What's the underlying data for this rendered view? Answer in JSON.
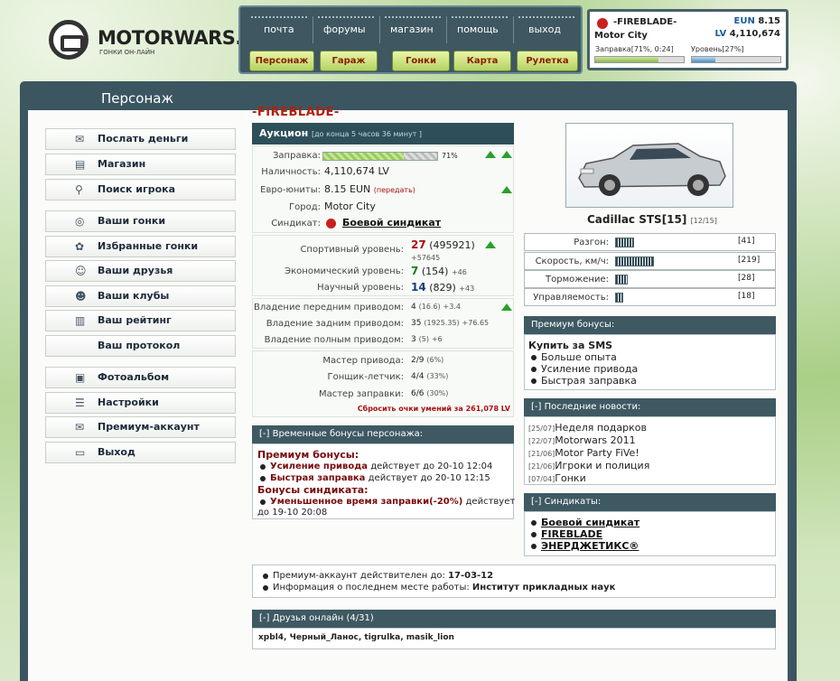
{
  "logo": {
    "name": "MOTORWARS.RU",
    "subtitle": "ГОНКИ ОН-ЛАЙН"
  },
  "nav": {
    "top": [
      "почта",
      "форумы",
      "магазин",
      "помощь",
      "выход"
    ],
    "buttons": [
      "Персонаж",
      "Гараж",
      "Гонки",
      "Карта",
      "Рулетка"
    ]
  },
  "player": {
    "name": "-FIREBLADE-",
    "city": "Motor City",
    "eun_label": "EUN",
    "eun": "8.15",
    "lv_label": "LV",
    "lv": "4,110,674",
    "fuel_label": "Заправка[71%, 0:24]",
    "fuel_pct": 71,
    "level_label": "Уровень[27%]",
    "level_pct": 27
  },
  "sidebar": {
    "title": "Персонаж",
    "items": [
      {
        "label": "Послать деньги",
        "icon": "money-icon"
      },
      {
        "label": "Магазин",
        "icon": "shop-icon"
      },
      {
        "label": "Поиск игрока",
        "icon": "search-icon"
      },
      {
        "label": "Ваши гонки",
        "icon": "steering-wheel-icon"
      },
      {
        "label": "Избранные гонки",
        "icon": "favorite-icon"
      },
      {
        "label": "Ваши друзья",
        "icon": "friends-icon"
      },
      {
        "label": "Ваши клубы",
        "icon": "clubs-icon"
      },
      {
        "label": "Ваш рейтинг",
        "icon": "rating-icon"
      },
      {
        "label": "Ваш протокол",
        "icon": ""
      },
      {
        "label": "Фотоальбом",
        "icon": "camera-icon"
      },
      {
        "label": "Настройки",
        "icon": "settings-icon"
      },
      {
        "label": "Премиум-аккаунт",
        "icon": "premium-icon"
      },
      {
        "label": "Выход",
        "icon": "exit-icon"
      }
    ]
  },
  "char": {
    "title": "-FIREBLADE-",
    "auction": {
      "label": "Аукцион",
      "note": "[до конца 5 часов 36 минут ]"
    },
    "fuel": {
      "label": "Заправка:",
      "pct_text": "71%",
      "pct": 71
    },
    "cash": {
      "label": "Наличность:",
      "value": "4,110,674 LV"
    },
    "euro": {
      "label": "Евро-юниты:",
      "value": "8.15 EUN",
      "link": "(передать)"
    },
    "city": {
      "label": "Город:",
      "value": "Motor City"
    },
    "syndicate": {
      "label": "Синдикат:",
      "value": "Боевой синдикат"
    },
    "levels": [
      {
        "label": "Спортивный уровень:",
        "level": "27",
        "points": "(495921)",
        "delta": "+57645"
      },
      {
        "label": "Экономический уровень:",
        "level": "7",
        "points": "(154)",
        "delta": "+46"
      },
      {
        "label": "Научный уровень:",
        "level": "14",
        "points": "(829)",
        "delta": "+43"
      }
    ],
    "drives": [
      {
        "label": "Владение передним приводом:",
        "level": "4",
        "points": "(16.6)",
        "delta": "+3.4"
      },
      {
        "label": "Владение задним приводом:",
        "level": "35",
        "points": "(1925.35)",
        "delta": "+76.65"
      },
      {
        "label": "Владение полным приводом:",
        "level": "3",
        "points": "(5)",
        "delta": "+6"
      }
    ],
    "masters": [
      {
        "label": "Мастер привода:",
        "value": "2/9",
        "pct": "(6%)"
      },
      {
        "label": "Гонщик-летчик:",
        "value": "4/4",
        "pct": "(33%)"
      },
      {
        "label": "Мастер заправки:",
        "value": "6/6",
        "pct": "(30%)"
      }
    ],
    "reset": "Сбросить очки умений за 261,078 LV"
  },
  "bonuses": {
    "head": "[-]  Временные бонусы персонажа:",
    "premium_title": "Премиум бонусы:",
    "premium": [
      {
        "name": "Усиление привода",
        "text": "действует до 20-10 12:04"
      },
      {
        "name": "Быстрая заправка",
        "text": "действует до 20-10 12:15"
      }
    ],
    "synd_title": "Бонусы синдиката:",
    "synd": [
      {
        "name": "Уменьшенное время заправки(-20%)",
        "text": "действует"
      }
    ],
    "synd_tail": "до 19-10 20:08"
  },
  "car": {
    "name": "Cadillac STS[15]",
    "slots": "[12/15]",
    "stats": [
      {
        "label": "Разгон:",
        "value": "[41]",
        "pct": 41
      },
      {
        "label": "Скорость, км/ч:",
        "value": "[219]",
        "pct": 85
      },
      {
        "label": "Торможение:",
        "value": "[28]",
        "pct": 28
      },
      {
        "label": "Управляемость:",
        "value": "[18]",
        "pct": 18
      }
    ]
  },
  "premium_box": {
    "head": "Премиум бонусы:",
    "title": "Купить за SMS",
    "items": [
      "Больше опыта",
      "Усиление привода",
      "Быстрая заправка"
    ]
  },
  "news": {
    "head": "[-]  Последние новости:",
    "items": [
      {
        "date": "[25/07]",
        "text": "Неделя подарков"
      },
      {
        "date": "[22/07]",
        "text": "Motorwars 2011"
      },
      {
        "date": "[21/06]",
        "text": "Motor Party FiVe!"
      },
      {
        "date": "[21/06]",
        "text": "Игроки и полиция"
      },
      {
        "date": "[07/04]",
        "text": "Гонки"
      }
    ]
  },
  "syndicates": {
    "head": "[-]  Синдикаты:",
    "items": [
      "Боевой синдикат",
      "FIREBLADE",
      "ЭНЕРДЖЕТИКС®"
    ]
  },
  "info": {
    "items": [
      {
        "label": "Премиум-аккаунт действителен до:",
        "value": "17-03-12"
      },
      {
        "label": "Информация о последнем месте работы:",
        "value": "Институт прикладных наук"
      }
    ]
  },
  "friends": {
    "head": "[-]  Друзья онлайн (4/31)",
    "list": "xpbl4, Черный_Ланос, tigrulka, masik_lion"
  }
}
